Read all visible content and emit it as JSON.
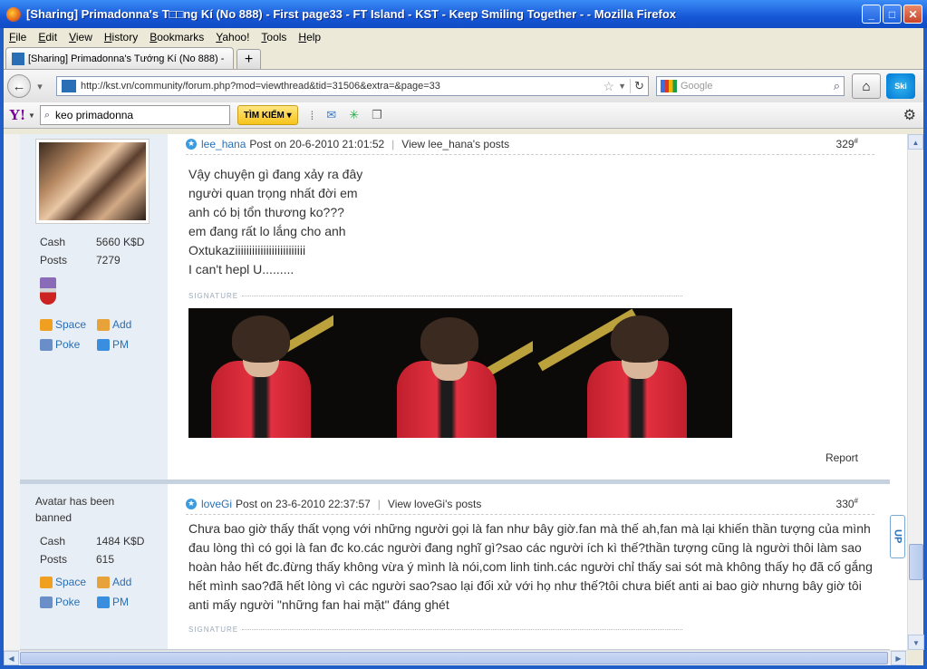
{
  "window": {
    "title": "[Sharing] Primadonna's T□□ng Kí (No 888) - First page33 - FT Island - KST - Keep Smiling Together - - Mozilla Firefox",
    "controls": [
      "_",
      "□",
      "✕"
    ]
  },
  "menu": [
    "File",
    "Edit",
    "View",
    "History",
    "Bookmarks",
    "Yahoo!",
    "Tools",
    "Help"
  ],
  "tab": {
    "label": "[Sharing] Primadonna's Tướng Kí (No 888) - ...",
    "new_tab": "+"
  },
  "nav": {
    "url": "http://kst.vn/community/forum.php?mod=viewthread&tid=31506&extra=&page=33",
    "search_placeholder": "Google",
    "skype_label": "Ski"
  },
  "yahoo": {
    "logo": "Y!",
    "search_value": "keo primadonna",
    "search_button": "TÌM KIẾM ▾"
  },
  "posts": [
    {
      "username": "lee_hana",
      "posted": "Post on 20-6-2010 21:01:52",
      "view_posts": "View lee_hana's posts",
      "number": "329",
      "sup": "#",
      "cash_label": "Cash",
      "cash_value": "5660 K$D",
      "posts_label": "Posts",
      "posts_value": "7279",
      "space": "Space",
      "add": "Add",
      "poke": "Poke",
      "pm": "PM",
      "body": [
        "Vậy chuyện gì đang xảy ra đây",
        "người quan trọng nhất đời em",
        "anh có bị tổn thương ko???",
        "em đang rất lo lắng cho anh",
        "Oxtukaziiiiiiiiiiiiiiiiiiiiiiiii",
        "I can't hepl U........."
      ],
      "signature": "SIGNATURE",
      "report": "Report"
    },
    {
      "username": "loveGi",
      "banned_note": "Avatar has been banned",
      "posted": "Post on 23-6-2010 22:37:57",
      "view_posts": "View loveGi's posts",
      "number": "330",
      "sup": "#",
      "cash_label": "Cash",
      "cash_value": "1484 K$D",
      "posts_label": "Posts",
      "posts_value": "615",
      "space": "Space",
      "add": "Add",
      "poke": "Poke",
      "pm": "PM",
      "body": "Chưa bao giờ thấy thất vọng với những người gọi là fan như bây giờ.fan mà thế ah,fan mà lại khiến thần tượng của mình đau lòng thì có gọi là fan đc ko.các người đang nghĩ gì?sao các người ích kì thế?thần tượng cũng là người thôi làm sao hoàn hảo hết đc.đừng thấy không vừa ý mình là nói,com linh tinh.các người chỉ thấy sai sót mà không thấy họ đã cố gắng hết mình sao?đã hết lòng vì các người sao?sao lại đối xử với họ như thế?tôi chưa biết anti ai bao giờ nhưng bây giờ tôi anti mấy người \"những fan hai mặt\" đáng ghét",
      "signature": "SIGNATURE"
    }
  ],
  "up_button": "UP",
  "colors": {
    "link": "#2a6fb5",
    "sidebar": "#e8eef5",
    "titlebar": "#1657d6"
  }
}
